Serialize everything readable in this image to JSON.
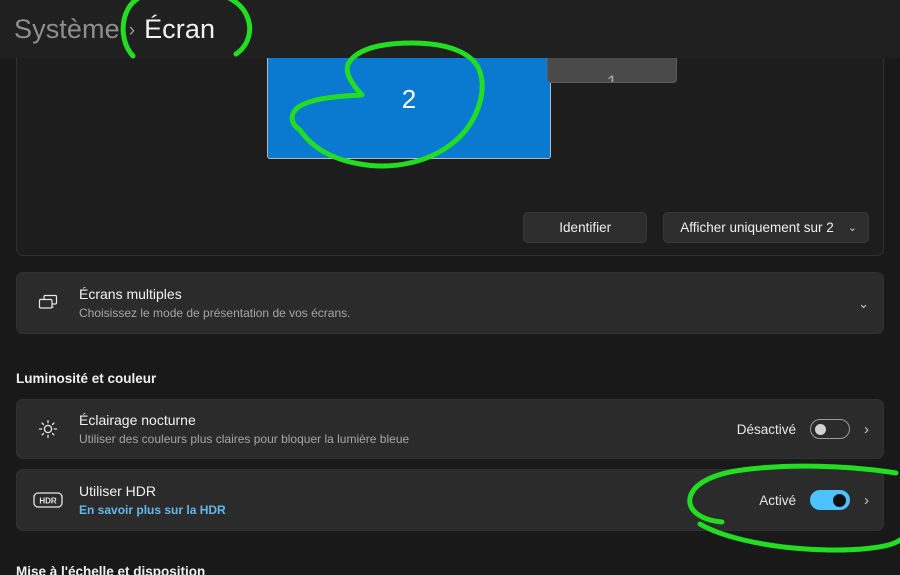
{
  "header": {
    "breadcrumb_parent": "Système",
    "breadcrumb_separator": "›",
    "breadcrumb_current": "Écran"
  },
  "arrangement": {
    "monitor_2_label": "2",
    "monitor_1_label": "1",
    "identify_button": "Identifier",
    "display_mode_value": "Afficher uniquement sur 2",
    "chevron": "⌄",
    "monitor_2_color": "#0a7ad1",
    "monitor_1_color": "#4a4a4a"
  },
  "multiple_displays": {
    "icon": "multiple-displays-icon",
    "title": "Écrans multiples",
    "subtitle": "Choisissez le mode de présentation de vos écrans.",
    "expand_chevron": "⌄"
  },
  "sections": {
    "brightness_color": "Luminosité et couleur",
    "scale_layout": "Mise à l'échelle et disposition"
  },
  "night_light": {
    "icon": "sun-icon",
    "title": "Éclairage nocturne",
    "subtitle": "Utiliser des couleurs plus claires pour bloquer la lumière bleue",
    "state": "Désactivé",
    "toggle_on": false,
    "chevron": "›"
  },
  "hdr": {
    "icon": "hdr-icon",
    "icon_text": "HDR",
    "title": "Utiliser HDR",
    "link": "En savoir plus sur la HDR",
    "link_color": "#63b8e8",
    "state": "Activé",
    "toggle_on": true,
    "toggle_color": "#4cc2ff",
    "chevron": "›"
  },
  "annotations": {
    "ink_color": "#22dd22",
    "marks": [
      "circle-around-ecran-breadcrumb",
      "circle-around-monitor-2",
      "ellipse-around-hdr-toggle"
    ]
  }
}
